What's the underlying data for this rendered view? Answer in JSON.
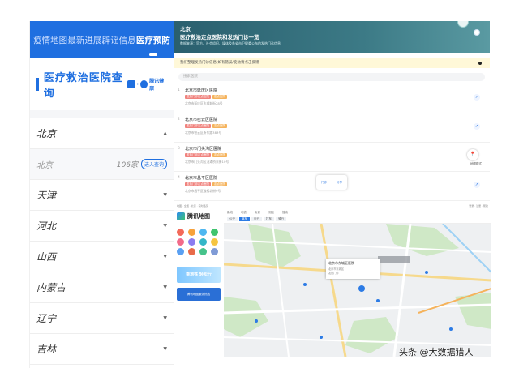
{
  "left_panel": {
    "nav_tabs": [
      "疫情地图",
      "最新进展",
      "辟谣信息",
      "医疗预防"
    ],
    "active_tab_index": 3,
    "title": "医疗救治医院查询",
    "partner_logo_text": "腾讯健康",
    "provinces": [
      {
        "name": "北京",
        "expanded": true
      },
      {
        "name": "天津"
      },
      {
        "name": "河北"
      },
      {
        "name": "山西"
      },
      {
        "name": "内蒙古"
      },
      {
        "name": "辽宁"
      },
      {
        "name": "吉林"
      }
    ],
    "sub_row": {
      "city": "北京",
      "count": "106家",
      "query": "进入查询"
    }
  },
  "right_top": {
    "hero_city": "北京",
    "hero_title": "医疗救治定点医院和发热门诊一览",
    "hero_subtitle": "数据来源：官方、社会组织、媒体及各省市卫健委公布的发热门诊信息",
    "notice": "我们整理发热门诊信息 如有错误/变动请点击反馈",
    "search_placeholder": "搜索医院",
    "hospitals": [
      {
        "index": "1",
        "name": "北京市延庆区医院",
        "tags": [
          "发热门诊定点医院",
          "定点医院"
        ],
        "address": "北京市延庆区东顺城街28号"
      },
      {
        "index": "2",
        "name": "北京市密云区医院",
        "tags": [
          "发热门诊定点医院",
          "定点医院"
        ],
        "address": "北京市密云区新东路383号"
      },
      {
        "index": "3",
        "name": "北京市门头沟区医院",
        "tags": [
          "发热门诊定点医院",
          "定点医院"
        ],
        "address": "北京市门头沟区河滩桥东街10号"
      },
      {
        "index": "4",
        "name": "北京市昌平区医院",
        "tags": [
          "发热门诊定点医院",
          "定点医院"
        ],
        "address": "北京市昌平区鼓楼北街9号"
      }
    ],
    "map_mode_label": "地图模式",
    "fab": {
      "left": "门诊",
      "right": "分享"
    }
  },
  "map": {
    "brand": "腾讯地图",
    "top_left": "地图 · 全国 · 北京 · 实时路况",
    "top_right": "登录 · 注册 · 帮助",
    "toolbar_items": [
      "路线",
      "地铁",
      "街景",
      "测距",
      "搜索"
    ],
    "tabs": [
      "公交",
      "驾车",
      "步行",
      "打车",
      "骑行"
    ],
    "active_tab_index": 1,
    "banner1": "乘地铁 轻松行",
    "banner2": "腾讯地图服务热线",
    "popup_title": "北京市东城区医院",
    "popup_lines": [
      "北京市东城区",
      "发热门诊"
    ],
    "icon_colors": [
      "#f36a5a",
      "#f7a23c",
      "#4fb7f0",
      "#3fc46f",
      "#f26b8a",
      "#8c7cf0",
      "#34b6c7",
      "#f5c542",
      "#5aa0f2",
      "#e86b4a",
      "#46c38b",
      "#7f9bd6"
    ]
  },
  "watermark": "头条 @大数据猎人"
}
